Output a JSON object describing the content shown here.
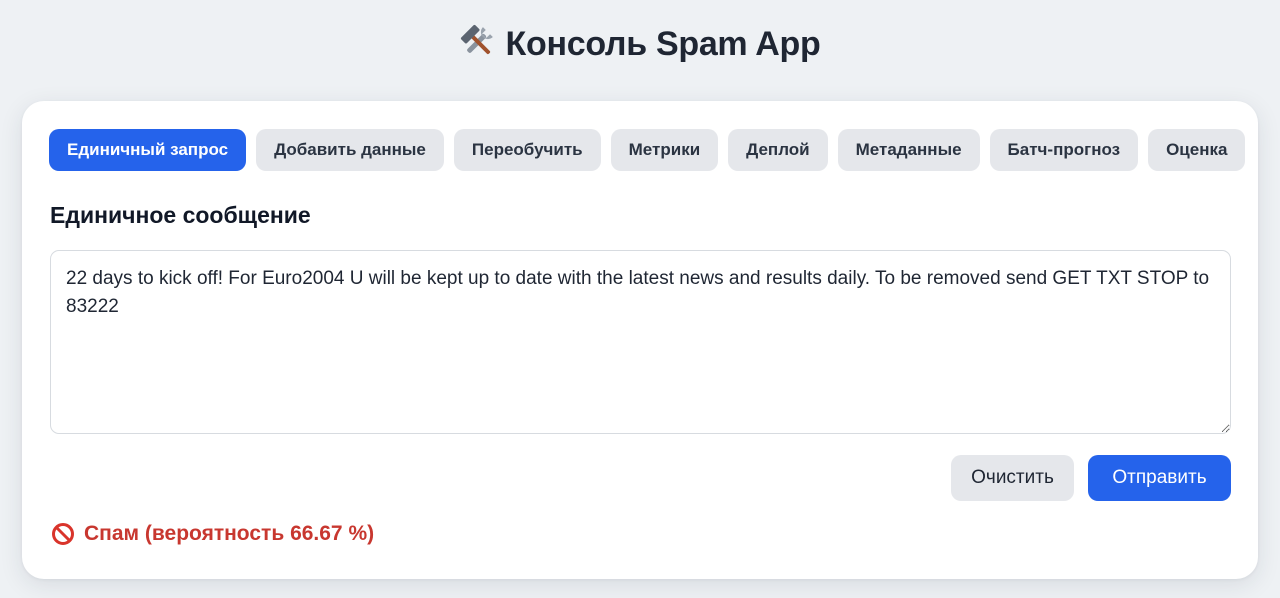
{
  "header": {
    "title": "Консоль Spam App",
    "icon": "hammer-and-wrench-icon"
  },
  "tabs": [
    {
      "label": "Единичный запрос",
      "active": true
    },
    {
      "label": "Добавить данные",
      "active": false
    },
    {
      "label": "Переобучить",
      "active": false
    },
    {
      "label": "Метрики",
      "active": false
    },
    {
      "label": "Деплой",
      "active": false
    },
    {
      "label": "Метаданные",
      "active": false
    },
    {
      "label": "Батч-прогноз",
      "active": false
    },
    {
      "label": "Оценка",
      "active": false
    }
  ],
  "main": {
    "heading": "Единичное сообщение",
    "message_value": "22 days to kick off! For Euro2004 U will be kept up to date with the latest news and results daily. To be removed send GET TXT STOP to 83222",
    "clear_label": "Очистить",
    "send_label": "Отправить",
    "result": {
      "icon": "prohibited-icon",
      "text": "Спам (вероятность 66.67 %)",
      "color": "#c8372f"
    }
  },
  "colors": {
    "accent": "#2563eb",
    "tab_inactive_bg": "#e5e7eb",
    "background": "#eef1f4",
    "spam": "#c8372f"
  }
}
